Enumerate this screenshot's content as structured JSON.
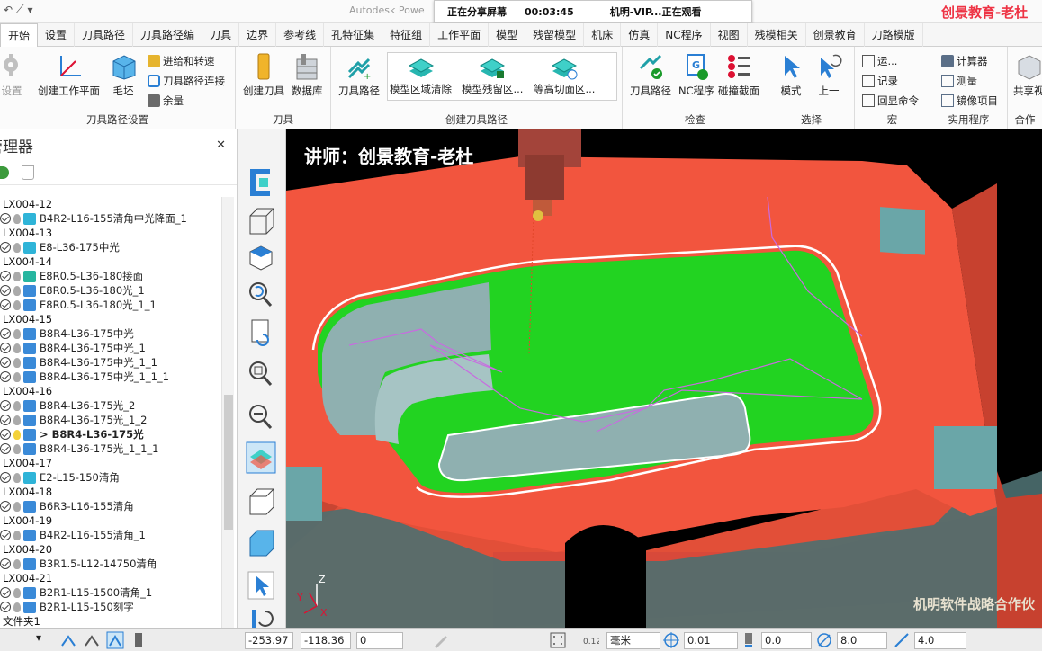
{
  "app": {
    "title": "Autodesk Powe",
    "brand_watermark": "创景教育-老杜"
  },
  "share_banner": {
    "status": "正在分享屏幕",
    "elapsed": "00:03:45",
    "viewer": "机明-VIP...正在观看"
  },
  "tabs": [
    "开始",
    "设置",
    "刀具路径",
    "刀具路径编",
    "刀具",
    "边界",
    "参考线",
    "孔特征集",
    "特征组",
    "工作平面",
    "模型",
    "残留模型",
    "机床",
    "仿真",
    "NC程序",
    "视图",
    "残模相关",
    "创景教育",
    "刀路模版"
  ],
  "active_tab": "开始",
  "ribbon": {
    "groups": {
      "toolpath_setup": "刀具路径设置",
      "tool": "刀具",
      "create_toolpath": "创建刀具路径",
      "inspect": "检查",
      "select": "选择",
      "macro": "宏",
      "utility": "实用程序",
      "share": "合作"
    },
    "buttons": {
      "setup": "设置",
      "create_workplane": "创建工作平面",
      "block": "毛坯",
      "feeds_speeds": "进给和转速",
      "toolpath_connections": "刀具路径连接",
      "allowance": "余量",
      "create_tool": "创建刀具",
      "database": "数据库",
      "toolpath": "刀具路径",
      "model_area_clearance": "模型区域清除",
      "model_rest_area": "模型残留区...",
      "constant_z": "等高切面区...",
      "toolpath_check": "刀具路径",
      "nc_program": "NC程序",
      "collision_section": "碰撞截面",
      "mode": "模式",
      "previous": "上一",
      "run": "运...",
      "record": "记录",
      "echo_commands": "回显命令",
      "calculator": "计算器",
      "measure": "测量",
      "mirror_item": "镜像项目",
      "share": "共享视"
    }
  },
  "explorer": {
    "title": "管理器",
    "rows": [
      {
        "type": "group",
        "label": "LX004-12"
      },
      {
        "type": "item",
        "label": "B4R2-L16-155清角中光降面_1",
        "icon": "cyan"
      },
      {
        "type": "group",
        "label": "LX004-13"
      },
      {
        "type": "item",
        "label": "E8-L36-175中光",
        "icon": "cyan"
      },
      {
        "type": "group",
        "label": "LX004-14"
      },
      {
        "type": "item",
        "label": "E8R0.5-L36-180接面",
        "icon": "teal"
      },
      {
        "type": "item",
        "label": "E8R0.5-L36-180光_1",
        "icon": "blue"
      },
      {
        "type": "item",
        "label": "E8R0.5-L36-180光_1_1",
        "icon": "blue"
      },
      {
        "type": "group",
        "label": "LX004-15"
      },
      {
        "type": "item",
        "label": "B8R4-L36-175中光",
        "icon": "blue"
      },
      {
        "type": "item",
        "label": "B8R4-L36-175中光_1",
        "icon": "blue"
      },
      {
        "type": "item",
        "label": "B8R4-L36-175中光_1_1",
        "icon": "blue"
      },
      {
        "type": "item",
        "label": "B8R4-L36-175中光_1_1_1",
        "icon": "blue"
      },
      {
        "type": "group",
        "label": "LX004-16"
      },
      {
        "type": "item",
        "label": "B8R4-L36-175光_2",
        "icon": "blue"
      },
      {
        "type": "item",
        "label": "B8R4-L36-175光_1_2",
        "icon": "blue"
      },
      {
        "type": "item",
        "label": "> B8R4-L36-175光",
        "icon": "blue",
        "selected": true
      },
      {
        "type": "item",
        "label": "B8R4-L36-175光_1_1_1",
        "icon": "blue"
      },
      {
        "type": "group",
        "label": "LX004-17"
      },
      {
        "type": "item",
        "label": "E2-L15-150清角",
        "icon": "cyan"
      },
      {
        "type": "group",
        "label": "LX004-18"
      },
      {
        "type": "item",
        "label": "B6R3-L16-155清角",
        "icon": "blue"
      },
      {
        "type": "group",
        "label": "LX004-19"
      },
      {
        "type": "item",
        "label": "B4R2-L16-155清角_1",
        "icon": "blue"
      },
      {
        "type": "group",
        "label": "LX004-20"
      },
      {
        "type": "item",
        "label": "B3R1.5-L12-14750清角",
        "icon": "blue"
      },
      {
        "type": "group",
        "label": "LX004-21"
      },
      {
        "type": "item",
        "label": "B2R1-L15-1500清角_1",
        "icon": "blue"
      },
      {
        "type": "item",
        "label": "B2R1-L15-150刻字",
        "icon": "blue"
      },
      {
        "type": "group",
        "label": "文件夹1"
      }
    ]
  },
  "viewport": {
    "lecturer": "讲师：创景教育-老杜",
    "watermark": "机明软件战略合作伙",
    "axes": {
      "z": "Z",
      "x": "X",
      "y": "Y"
    }
  },
  "status": {
    "x": "-253.97",
    "y": "-118.36",
    "z": "0",
    "units": "毫米",
    "tolerance": "0.01",
    "thickness": "0.0",
    "diameter": "8.0",
    "step": "4.0"
  },
  "colors": {
    "core_red": "#f2553e",
    "machined_green": "#22d321",
    "floor_grey": "#8fb0b0",
    "toolpath_magenta": "#c86be0",
    "accent_blue": "#2a7fd4"
  }
}
